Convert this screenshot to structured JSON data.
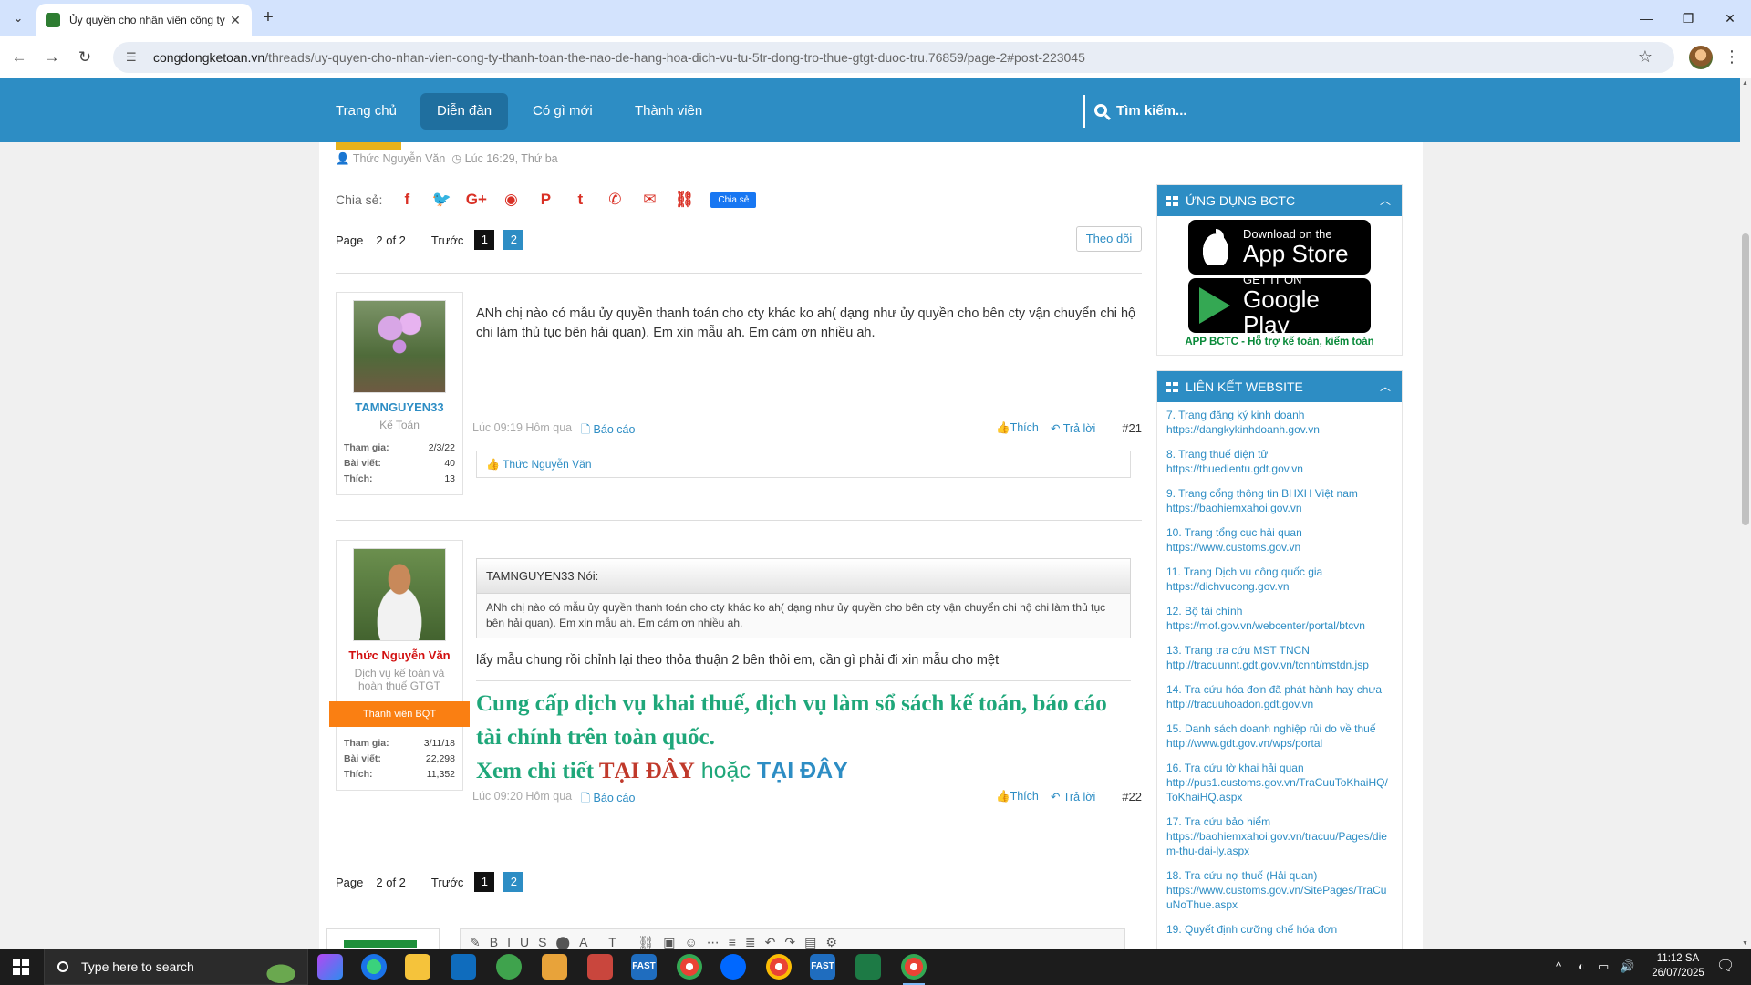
{
  "browser": {
    "tab_title": "Ủy quyền cho nhân viên công ty thanh toán",
    "url_domain": "congdongketoan.vn",
    "url_path": "/threads/uy-quyen-cho-nhan-vien-cong-ty-thanh-toan-the-nao-de-hang-hoa-dich-vu-tu-5tr-dong-tro-thue-gtgt-duoc-tru.76859/page-2#post-223045"
  },
  "nav": {
    "items": [
      "Trang chủ",
      "Diễn đàn",
      "Có gì mới",
      "Thành viên"
    ],
    "search_label": "Tìm kiếm..."
  },
  "thread": {
    "author": "Thức Nguyễn Văn",
    "time": "Lúc 16:29, Thứ ba",
    "share_label": "Chia sẻ:",
    "share_messenger": "Chia sẻ",
    "follow_label": "Theo dõi"
  },
  "pager": {
    "page_label": "Page",
    "of_label": "2 of 2",
    "prev_label": "Trước",
    "pages": [
      "1",
      "2"
    ]
  },
  "posts": [
    {
      "username": "TAMNGUYEN33",
      "user_title": "Kế Toán",
      "stats": [
        {
          "k": "Tham gia:",
          "v": "2/3/22"
        },
        {
          "k": "Bài viết:",
          "v": "40"
        },
        {
          "k": "Thích:",
          "v": "13"
        }
      ],
      "text": "ANh chị nào có mẫu ủy quyền thanh toán cho cty khác ko ah( dạng như ủy quyền cho bên cty vận chuyển chi hộ chi làm thủ tục bên hải quan). Em xin mẫu ah. Em cám ơn nhiều ah.",
      "time": "Lúc 09:19 Hôm qua",
      "report": "Báo cáo",
      "like": "Thích",
      "reply": "Trả lời",
      "number": "#21",
      "liked_by": "Thức Nguyễn Văn"
    },
    {
      "username": "Thức Nguyễn Văn",
      "user_title": "Dịch vụ kế toán và hoàn thuế GTGT",
      "badge": "Thành viên BQT",
      "stats": [
        {
          "k": "Tham gia:",
          "v": "3/11/18"
        },
        {
          "k": "Bài viết:",
          "v": "22,298"
        },
        {
          "k": "Thích:",
          "v": "11,352"
        }
      ],
      "quote_header": "TAMNGUYEN33 Nói:",
      "quote_text": "ANh chị nào có mẫu ủy quyền thanh toán cho cty khác ko ah( dạng như ủy quyền cho bên cty vận chuyển chi hộ chi làm thủ tục bên hải quan). Em xin mẫu ah. Em cám ơn nhiều ah.",
      "text": "lấy mẫu chung rồi chỉnh lại theo thỏa thuận 2 bên thôi em, cần gì phải đi xin mẫu cho mệt",
      "sig_line1": "Cung cấp dịch vụ khai thuế, dịch vụ làm sổ sách kế toán, báo cáo tài chính trên toàn quốc.",
      "sig_a": "Xem chi tiết ",
      "sig_b": "TẠI ĐÂY",
      "sig_c": " hoặc ",
      "sig_d": "TẠI ĐÂY",
      "time": "Lúc 09:20 Hôm qua",
      "report": "Báo cáo",
      "like": "Thích",
      "reply": "Trả lời",
      "number": "#22"
    }
  ],
  "sidebar": {
    "app_title": "ỨNG DỤNG BCTC",
    "appstore_small": "Download on the",
    "appstore_big": "App Store",
    "play_small": "GET IT ON",
    "play_big": "Google Play",
    "app_tagline": "APP BCTC - Hỗ trợ kế toán, kiểm toán",
    "links_title": "LIÊN KẾT WEBSITE",
    "links": [
      {
        "name": "7. Trang đăng ký kinh doanh",
        "url": "https://dangkykinhdoanh.gov.vn"
      },
      {
        "name": "8. Trang thuế điện tử",
        "url": "https://thuedientu.gdt.gov.vn"
      },
      {
        "name": "9. Trang cổng thông tin BHXH Việt nam",
        "url": "https://baohiemxahoi.gov.vn"
      },
      {
        "name": "10. Trang tổng cục hải quan",
        "url": "https://www.customs.gov.vn"
      },
      {
        "name": "11. Trang Dịch vụ công quốc gia",
        "url": "https://dichvucong.gov.vn"
      },
      {
        "name": "12. Bộ tài chính",
        "url": "https://mof.gov.vn/webcenter/portal/btcvn"
      },
      {
        "name": "13. Trang tra cứu MST TNCN",
        "url": "http://tracuunnt.gdt.gov.vn/tcnnt/mstdn.jsp"
      },
      {
        "name": "14. Tra cứu hóa đơn đã phát hành hay chưa",
        "url": "http://tracuuhoadon.gdt.gov.vn"
      },
      {
        "name": "15. Danh sách doanh nghiệp rủi do về thuế",
        "url": "http://www.gdt.gov.vn/wps/portal"
      },
      {
        "name": "16. Tra cứu tờ khai hải quan",
        "url": "http://pus1.customs.gov.vn/TraCuuToKhaiHQ/ToKhaiHQ.aspx"
      },
      {
        "name": "17. Tra cứu bảo hiểm",
        "url": "https://baohiemxahoi.gov.vn/tracuu/Pages/diem-thu-dai-ly.aspx"
      },
      {
        "name": "18. Tra cứu nợ thuế (Hải quan)",
        "url": "https://www.customs.gov.vn/SitePages/TraCuuNoThue.aspx"
      },
      {
        "name": "19. Quyết định cưỡng chế hóa đơn",
        "url": ""
      }
    ]
  },
  "taskbar": {
    "search_placeholder": "Type here to search",
    "time": "11:12 SA",
    "date": "26/07/2025",
    "fast_label": "FAST"
  }
}
